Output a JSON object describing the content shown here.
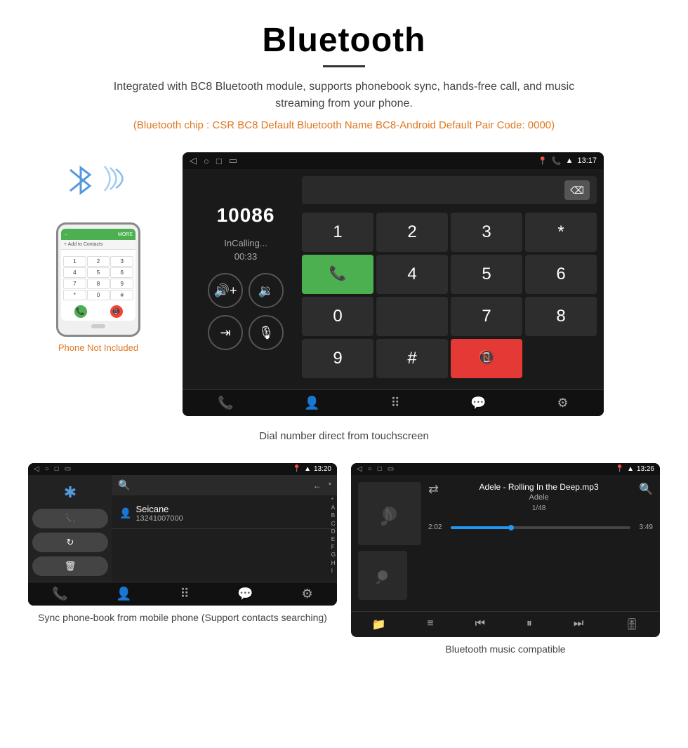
{
  "header": {
    "title": "Bluetooth",
    "subtitle": "Integrated with BC8 Bluetooth module, supports phonebook sync, hands-free call, and music streaming from your phone.",
    "chip_info": "(Bluetooth chip : CSR BC8    Default Bluetooth Name BC8-Android    Default Pair Code: 0000)"
  },
  "dial_screen": {
    "time": "13:17",
    "number": "10086",
    "status": "InCalling...",
    "timer": "00:33",
    "keys": [
      "1",
      "2",
      "3",
      "*",
      "",
      "4",
      "5",
      "6",
      "0",
      "",
      "7",
      "8",
      "9",
      "#",
      ""
    ],
    "caption": "Dial number direct from touchscreen"
  },
  "phonebook_screen": {
    "time": "13:20",
    "contact_name": "Seicane",
    "contact_number": "13241007000",
    "alphabet": [
      "*",
      "A",
      "B",
      "C",
      "D",
      "E",
      "F",
      "G",
      "H",
      "I"
    ],
    "caption": "Sync phone-book from mobile phone\n(Support contacts searching)"
  },
  "music_screen": {
    "time": "13:26",
    "song_title": "Adele - Rolling In the Deep.mp3",
    "artist": "Adele",
    "track_info": "1/48",
    "time_current": "2:02",
    "time_total": "3:49",
    "caption": "Bluetooth music compatible"
  },
  "phone_illustration": {
    "not_included": "Phone Not Included"
  }
}
